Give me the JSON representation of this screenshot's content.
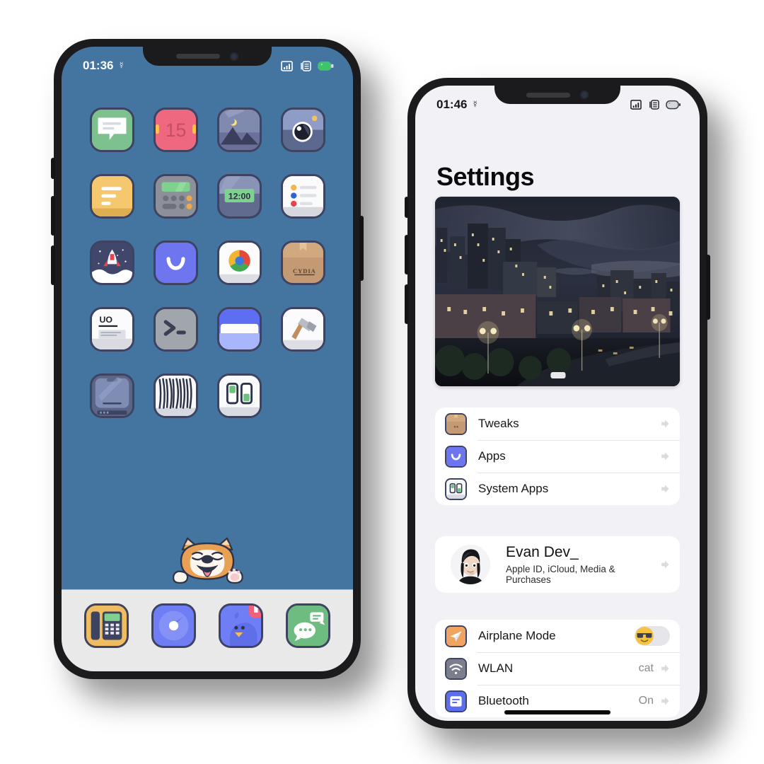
{
  "theme": {
    "wallpaper_color": "#4474a0",
    "dock_color": "#e9e9e9",
    "icon_border_color": "#3d4360",
    "settings_bg": "#f2f2f6",
    "card_bg": "#ffffff",
    "accent_pink": "#f2607a"
  },
  "home_screen": {
    "status_bar": {
      "time": "01:36",
      "location_icon": "location-arrow-icon",
      "signal_icon": "cellular-signal-icon",
      "sim_icon": "dual-sim-icon",
      "battery_icon": "battery-charging-icon",
      "battery_color": "#3ec46d"
    },
    "apps": [
      {
        "name": "Messages",
        "icon": "messages-bubble-icon",
        "slot": 1
      },
      {
        "name": "Calendar",
        "icon": "calendar-icon",
        "slot": 2,
        "day": "15"
      },
      {
        "name": "Photos",
        "icon": "photos-mountain-icon",
        "slot": 3
      },
      {
        "name": "Camera",
        "icon": "camera-lens-icon",
        "slot": 4
      },
      {
        "name": "Notes",
        "icon": "notes-lines-icon",
        "slot": 5
      },
      {
        "name": "Calculator",
        "icon": "calculator-icon",
        "slot": 6
      },
      {
        "name": "Clock",
        "icon": "clock-digital-icon",
        "slot": 7,
        "display": "12:00"
      },
      {
        "name": "Reminders",
        "icon": "reminders-list-icon",
        "slot": 8
      },
      {
        "name": "TestFlight",
        "icon": "rocket-launch-icon",
        "slot": 9
      },
      {
        "name": "App Store",
        "icon": "smile-bag-icon",
        "slot": 10
      },
      {
        "name": "Chrome",
        "icon": "chrome-icon",
        "slot": 11
      },
      {
        "name": "Cydia",
        "icon": "cydia-box-icon",
        "slot": 12,
        "box_label": "CYDIA"
      },
      {
        "name": "UO",
        "icon": "uo-card-icon",
        "slot": 13,
        "card_label": "UO"
      },
      {
        "name": "Terminal",
        "icon": "terminal-prompt-icon",
        "slot": 14
      },
      {
        "name": "Files",
        "icon": "files-folder-icon",
        "slot": 15
      },
      {
        "name": "Tools",
        "icon": "hammer-icon",
        "slot": 16
      },
      {
        "name": "Device",
        "icon": "iphone-device-icon",
        "slot": 17
      },
      {
        "name": "Zebra",
        "icon": "zebra-stripes-icon",
        "slot": 18
      },
      {
        "name": "System Apps",
        "icon": "system-apps-icon",
        "slot": 19
      }
    ],
    "dock": [
      {
        "name": "Phone",
        "icon": "desk-phone-icon",
        "badge": null
      },
      {
        "name": "Safari",
        "icon": "compass-icon",
        "badge": null
      },
      {
        "name": "Twitter",
        "icon": "bird-icon",
        "badge": "flag-badge"
      },
      {
        "name": "WeChat",
        "icon": "chat-bubbles-icon",
        "badge": null
      }
    ],
    "mascot": {
      "name": "shiba-inu-peeking",
      "description": "Shiba Inu peeking over the dock with tongue out and paw raised"
    }
  },
  "settings_screen": {
    "status_bar": {
      "time": "01:46",
      "location_icon": "location-arrow-icon",
      "signal_icon": "cellular-signal-icon",
      "sim_icon": "dual-sim-icon",
      "battery_icon": "battery-icon"
    },
    "title": "Settings",
    "hero_photo": {
      "name": "night-cityscape-photo",
      "alt": "Night cityscape with apartment towers, street lamps and a road"
    },
    "groups": [
      {
        "id": "apps",
        "rows": [
          {
            "label": "Tweaks",
            "icon": "cydia-box-icon",
            "value": "",
            "accessory": "chevron-right-icon"
          },
          {
            "label": "Apps",
            "icon": "smile-bag-icon",
            "value": "",
            "accessory": "chevron-right-icon"
          },
          {
            "label": "System Apps",
            "icon": "system-apps-icon",
            "value": "",
            "accessory": "chevron-right-icon"
          }
        ]
      },
      {
        "id": "account",
        "rows": [
          {
            "label": "Evan Dev_",
            "subtitle": "Apple ID, iCloud, Media & Purchases",
            "icon": "anime-avatar",
            "accessory": "chevron-right-icon"
          }
        ]
      },
      {
        "id": "connectivity",
        "rows": [
          {
            "label": "Airplane Mode",
            "icon": "airplane-icon",
            "value": "",
            "accessory": "toggle",
            "toggle_on": false,
            "knob_icon": "sunglasses-emoji"
          },
          {
            "label": "WLAN",
            "icon": "wifi-icon",
            "value": "cat",
            "accessory": "chevron-right-icon"
          },
          {
            "label": "Bluetooth",
            "icon": "bluetooth-icon",
            "value": "On",
            "accessory": "chevron-right-icon"
          }
        ]
      }
    ]
  }
}
